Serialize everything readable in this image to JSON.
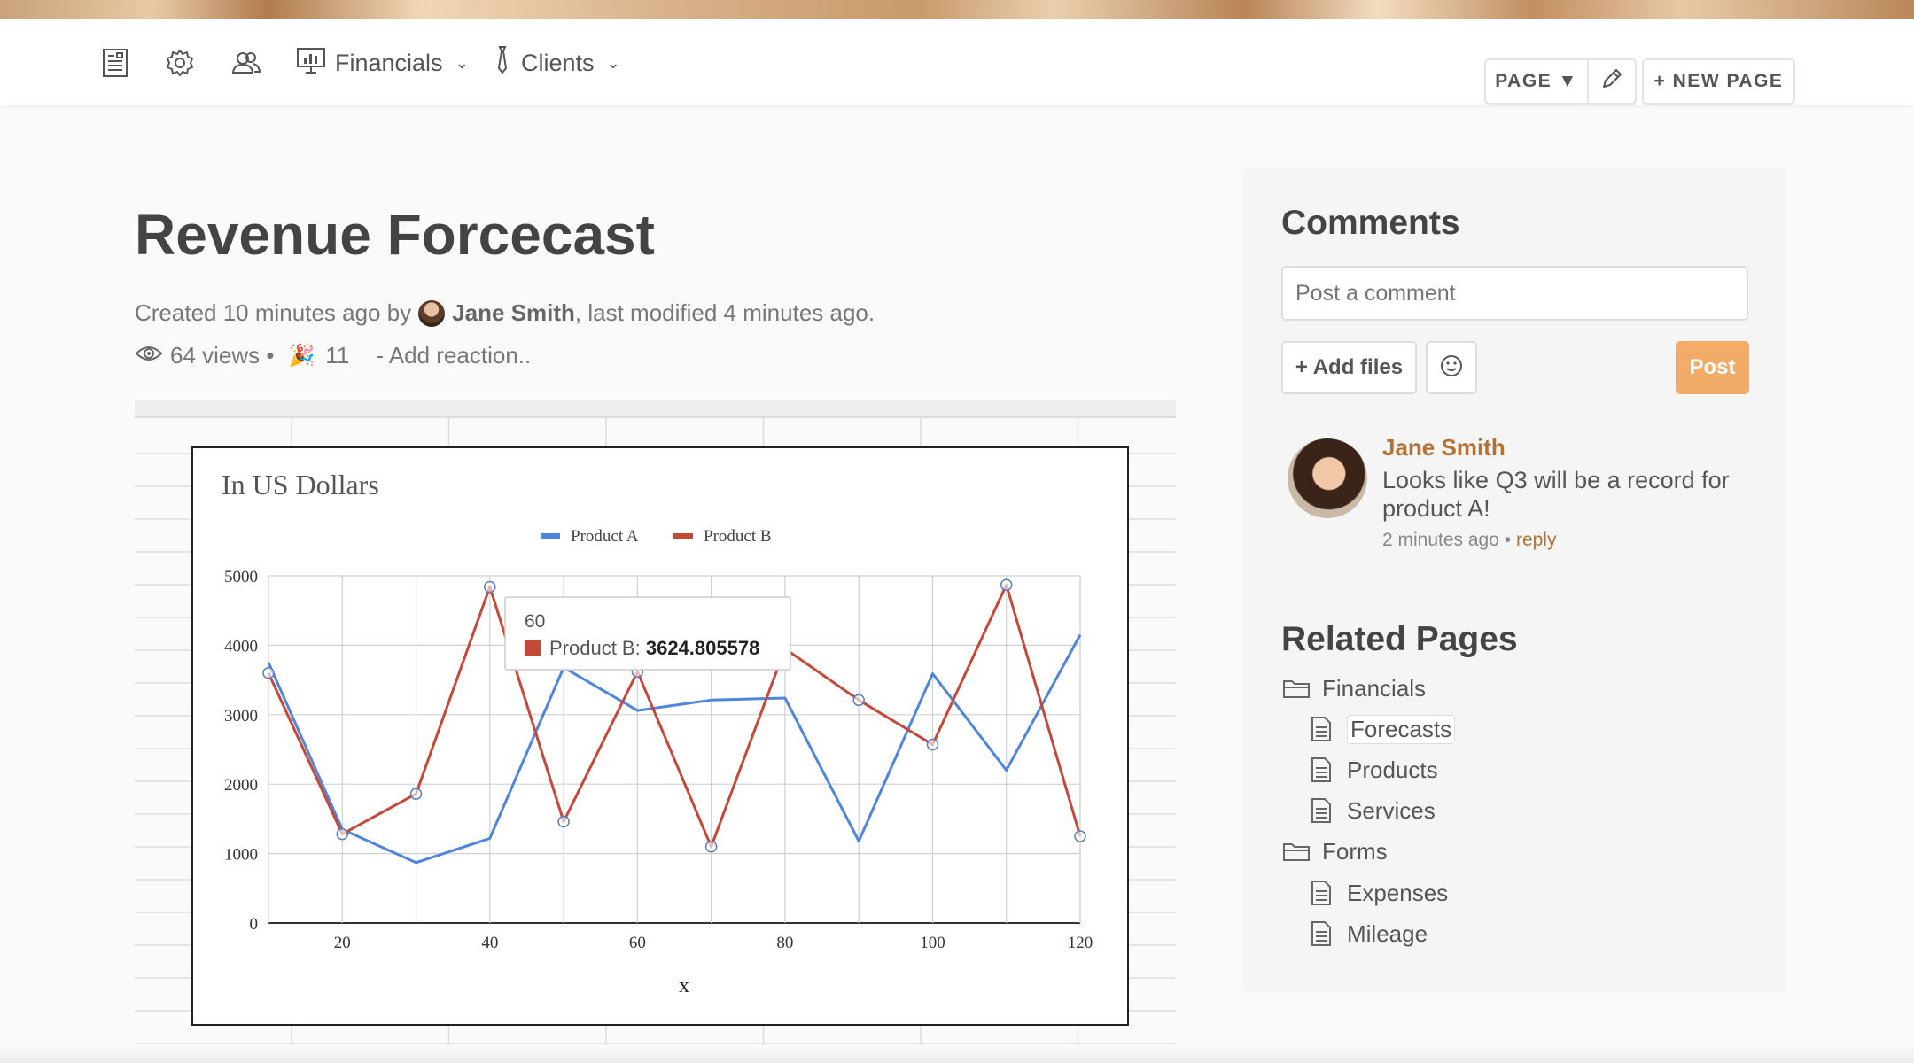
{
  "navbar": {
    "icons": [
      "document-list-icon",
      "gear-icon",
      "users-icon"
    ],
    "menus": [
      {
        "label": "Financials",
        "icon": "presentation-chart-icon"
      },
      {
        "label": "Clients",
        "icon": "tie-icon"
      }
    ],
    "page_button": "PAGE ▼",
    "new_page_button": "+ NEW PAGE"
  },
  "page": {
    "title": "Revenue Forcecast",
    "created_prefix": "Created 10 minutes ago by",
    "author": "Jane Smith",
    "modified_suffix": ", last modified 4 minutes ago.",
    "views": "64 views •",
    "reaction_count": "11",
    "add_reaction": "- Add reaction.."
  },
  "chart_data": {
    "type": "line",
    "title": "In US Dollars",
    "xlabel": "x",
    "ylabel": "",
    "x": [
      10,
      20,
      30,
      40,
      50,
      60,
      70,
      80,
      90,
      100,
      110,
      120
    ],
    "xticks": [
      20,
      40,
      60,
      80,
      100,
      120
    ],
    "ylim": [
      0,
      5000
    ],
    "yticks": [
      0,
      1000,
      2000,
      3000,
      4000,
      5000
    ],
    "grid": true,
    "legend": "top-center",
    "series": [
      {
        "name": "Product A",
        "color": "#4f86d9",
        "values": [
          3750,
          1350,
          870,
          1220,
          3680,
          3060,
          3210,
          3240,
          1180,
          3590,
          2200,
          4150
        ]
      },
      {
        "name": "Product B",
        "color": "#c4493a",
        "values": [
          3600,
          1280,
          1860,
          4840,
          1460,
          3620,
          1100,
          3950,
          3210,
          2570,
          4870,
          1250
        ]
      }
    ],
    "tooltip": {
      "x_label": "60",
      "series": "Product B",
      "value": "3624.805578"
    }
  },
  "comments": {
    "title": "Comments",
    "placeholder": "Post a comment",
    "add_files": "+ Add files",
    "post_button": "Post",
    "items": [
      {
        "author": "Jane Smith",
        "text": "Looks like Q3 will be a record for product A!",
        "time": "2 minutes ago •",
        "reply": "reply"
      }
    ]
  },
  "related": {
    "title": "Related Pages",
    "items": [
      {
        "label": "Financials",
        "type": "folder"
      },
      {
        "label": "Forecasts",
        "type": "page"
      },
      {
        "label": "Products",
        "type": "page"
      },
      {
        "label": "Services",
        "type": "page"
      },
      {
        "label": "Forms",
        "type": "folder"
      },
      {
        "label": "Expenses",
        "type": "page"
      },
      {
        "label": "Mileage",
        "type": "page"
      }
    ]
  },
  "colors": {
    "accent": "#f3ac68",
    "link": "#b37233",
    "product_a": "#4f86d9",
    "product_b": "#c4493a"
  }
}
